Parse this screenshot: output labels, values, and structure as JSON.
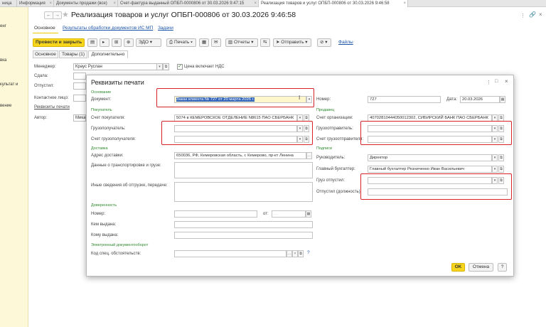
{
  "tabs": [
    {
      "label": "ница"
    },
    {
      "label": "Информация"
    },
    {
      "label": "Документы продажи (все)"
    },
    {
      "label": "Счет-фактура выданный ОПБП-0000806 от 30.03.2026 9:47:15"
    },
    {
      "label": "Реализация товаров и услуг ОПБП-000806 от 30.03.2026 9:46:58"
    }
  ],
  "sidebar": {
    "items": [
      "енг",
      "вка",
      "культат и",
      "вение"
    ]
  },
  "header": {
    "back": "←",
    "forward": "→",
    "star": "★",
    "title": "Реализация товаров и услуг ОПБП-000806 от 30.03.2026 9:46:58"
  },
  "subnav": {
    "main": "Основное",
    "results": "Результаты обработки документов ИС МП",
    "tasks": "Задачи"
  },
  "toolbar": {
    "post_close": "Провести и закрыть",
    "edo": "ЭДО",
    "print": "Печать",
    "reports": "Отчеты",
    "send": "Отправить",
    "files": "Файлы"
  },
  "formtabs": [
    "Основное",
    "Товары (1)",
    "Дополнительно"
  ],
  "form": {
    "manager_label": "Менеджер:",
    "manager_value": "Краус Руслан",
    "vat_label": "Цена включает НДС",
    "handed_label": "Сдала:",
    "shipped_label": "Отпустил:",
    "contact_label": "Контактное лицо:",
    "print_link": "Реквизиты печати",
    "author_label": "Автор:",
    "author_value": "Мика"
  },
  "dialog": {
    "title": "Реквизиты печати",
    "sec_basis": "Основание",
    "doc_label": "Документ:",
    "doc_value": "Заказ клиента № 727 от 20 марта 2026 г.",
    "number_label": "Номер:",
    "number_value": "727",
    "date_label": "Дата:",
    "date_value": "20.03.2026",
    "sec_buyer": "Покупатель",
    "buyer_acct_label": "Счет покупателя:",
    "buyer_acct_value": "5074 в КЕМЕРОВСКОЕ ОТДЕЛЕНИЕ N8615 ПАО СБЕРБАНК",
    "consignee_label": "Грузополучатель:",
    "consignee_acct_label": "Счет грузополучателя:",
    "sec_seller": "Продавец",
    "org_acct_label": "Счет организации:",
    "org_acct_value": "40702810444050012302, СИБИРСКИЙ БАНК ПАО СБЕРБАНК",
    "shipper_label": "Грузоотправитель:",
    "shipper_acct_label": "Счет грузоотправителя:",
    "sec_delivery": "Доставка",
    "address_label": "Адрес доставки:",
    "address_value": "650036, РФ, Кемеровская область, г. Кемерово, пр-кт Ленина",
    "transport_label": "Данные о транспортировке и грузе:",
    "other_label": "Иные сведения об отгрузке, передаче:",
    "sec_signatures": "Подписи",
    "head_label": "Руководитель:",
    "head_value": "Директор",
    "chief_acc_label": "Главный бухгалтер:",
    "chief_acc_value": "Главный бухгалтер Резниченко Иван Васильевич",
    "cargo_released_label": "Груз отпустил:",
    "released_pos_label": "Отпустил (должность):",
    "sec_proxy": "Доверенность",
    "proxy_num_label": "Номер:",
    "proxy_from_label": "от:",
    "proxy_date_ph": ". .",
    "issued_by_label": "Кем выдана:",
    "issued_to_label": "Кому выдана:",
    "sec_edo": "Электронный документооборот",
    "code_label": "Код спец. обстоятельств:",
    "ok": "OK",
    "cancel": "Отмена",
    "help": "?"
  },
  "colors": {
    "accent": "#f6d51c",
    "highlight": "#d8232a",
    "section": "#2e8b2e",
    "link": "#1a55a8"
  }
}
